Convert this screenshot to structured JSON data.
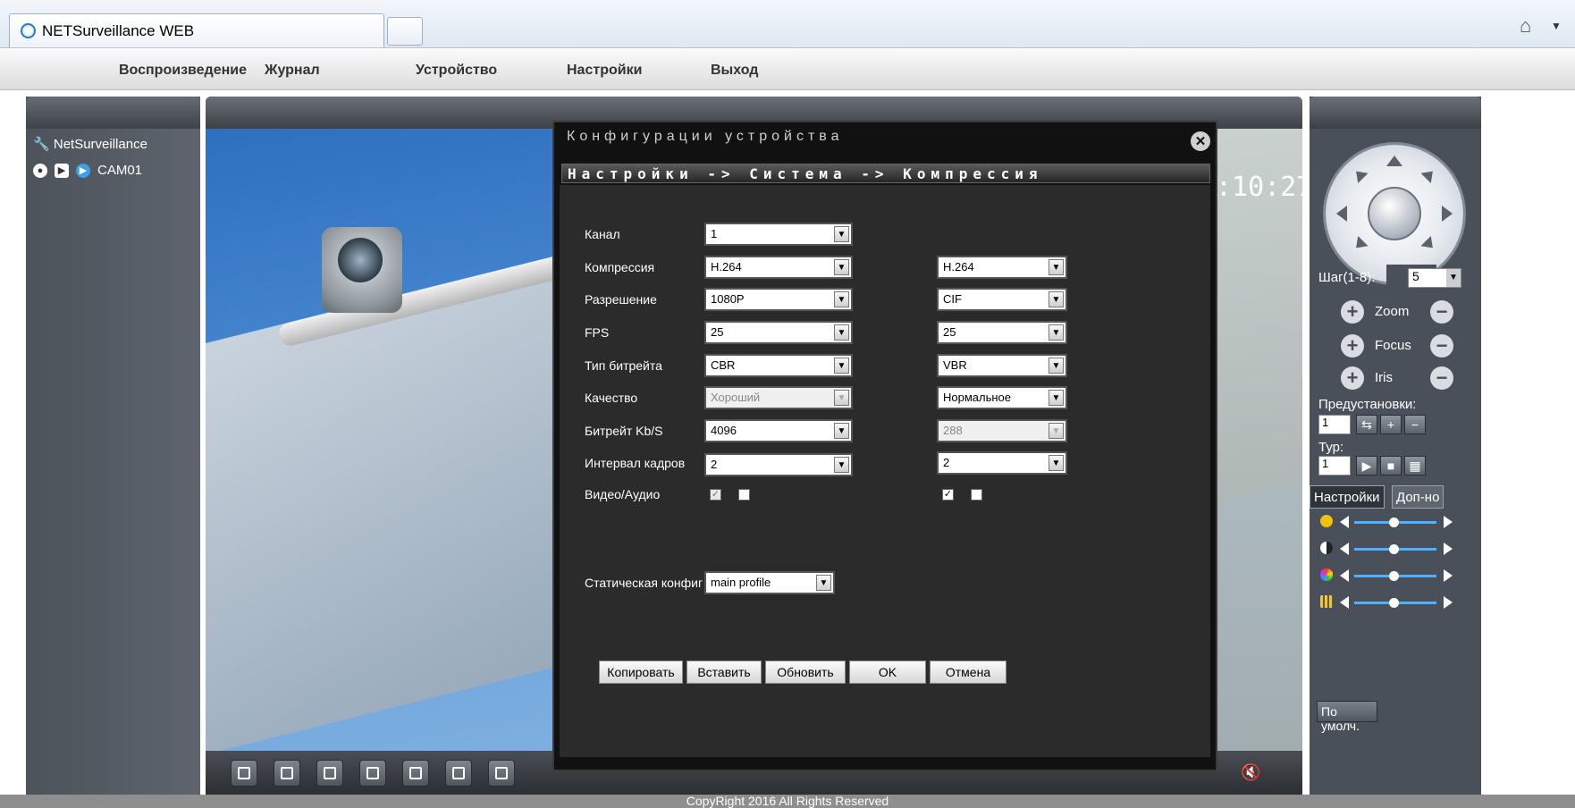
{
  "browser": {
    "tab_title": "NETSurveillance WEB",
    "home_icon": "home-icon"
  },
  "menu": {
    "items": [
      "Воспроизведение",
      "Журнал",
      "Устройство",
      "Настройки",
      "Выход"
    ]
  },
  "left_panel": {
    "root_label": "NetSurveillance",
    "camera_label": "CAM01"
  },
  "video": {
    "time_fragment": ":10:27"
  },
  "dialog": {
    "title": "Конфигурации устройства",
    "breadcrumb": "Настройки -> Система -> Компрессия",
    "rows": [
      {
        "label": "Канал",
        "main": "1",
        "extra": null
      },
      {
        "label": "Компрессия",
        "main": "H.264",
        "extra": "H.264"
      },
      {
        "label": "Разрешение",
        "main": "1080P",
        "extra": "CIF"
      },
      {
        "label": "FPS",
        "main": "25",
        "extra": "25"
      },
      {
        "label": "Тип битрейта",
        "main": "CBR",
        "extra": "VBR"
      },
      {
        "label": "Качество",
        "main": "Хороший",
        "extra": "Нормальное"
      },
      {
        "label": "Битрейт Kb/S",
        "main": "4096",
        "extra": "288"
      },
      {
        "label": "Интервал кадров",
        "main": "2",
        "extra": "2"
      }
    ],
    "av_label": "Видео/Аудио",
    "static_label": "Статическая конфиг",
    "static_value": "main profile",
    "buttons": {
      "copy": "Копировать",
      "paste": "Вставить",
      "refresh": "Обновить",
      "ok": "OK",
      "cancel": "Отмена"
    }
  },
  "right_panel": {
    "step_label": "Шаг(1-8):",
    "step_value": "5",
    "zoom": "Zoom",
    "focus": "Focus",
    "iris": "Iris",
    "presets_label": "Предустановки:",
    "preset_value": "1",
    "tour_label": "Тур:",
    "tour_value": "1",
    "tab_settings": "Настройки",
    "tab_extra": "Доп-но",
    "defaults_button": "По умолч."
  },
  "footer": {
    "copyright": "CopyRight 2016 All Rights Reserved"
  },
  "colors": {
    "dialog_bg": "#111111",
    "panel_bg": "#4a5059",
    "slider_accent": "#4fb0ff"
  }
}
